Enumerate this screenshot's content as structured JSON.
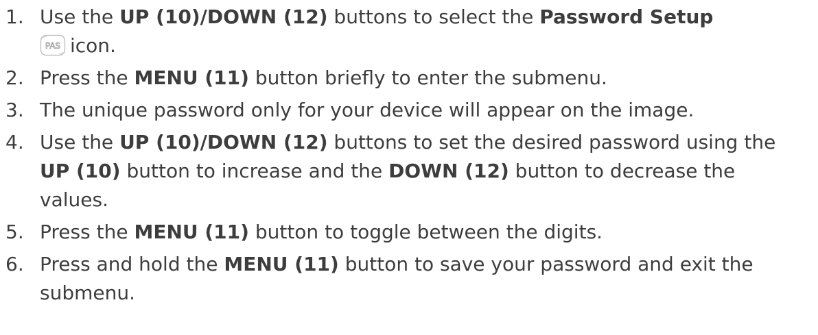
{
  "steps": [
    {
      "num": "1.",
      "parts": [
        {
          "t": "Use the ",
          "b": false
        },
        {
          "t": "UP (10)/DOWN (12)",
          "b": true
        },
        {
          "t": " buttons to select the ",
          "b": false
        },
        {
          "t": "Password Setup",
          "b": true
        },
        {
          "icon": "PAS"
        },
        {
          "t": "icon.",
          "b": false
        }
      ]
    },
    {
      "num": "2.",
      "parts": [
        {
          "t": "Press the ",
          "b": false
        },
        {
          "t": "MENU (11)",
          "b": true
        },
        {
          "t": " button briefly to enter the submenu.",
          "b": false
        }
      ]
    },
    {
      "num": "3.",
      "parts": [
        {
          "t": "The unique password only for your device will appear on the image.",
          "b": false
        }
      ]
    },
    {
      "num": "4.",
      "parts": [
        {
          "t": "Use the ",
          "b": false
        },
        {
          "t": "UP (10)/DOWN (12)",
          "b": true
        },
        {
          "t": " buttons to set the desired password using the ",
          "b": false
        },
        {
          "t": "UP (10)",
          "b": true
        },
        {
          "t": " button to increase and the ",
          "b": false
        },
        {
          "t": "DOWN (12)",
          "b": true
        },
        {
          "t": " button to decrease the values.",
          "b": false
        }
      ]
    },
    {
      "num": "5.",
      "parts": [
        {
          "t": "Press the ",
          "b": false
        },
        {
          "t": "MENU (11)",
          "b": true
        },
        {
          "t": " button to toggle between the digits.",
          "b": false
        }
      ]
    },
    {
      "num": "6.",
      "parts": [
        {
          "t": "Press and hold the ",
          "b": false
        },
        {
          "t": "MENU (11)",
          "b": true
        },
        {
          "t": " button to save your password and exit the submenu.",
          "b": false
        }
      ]
    }
  ]
}
